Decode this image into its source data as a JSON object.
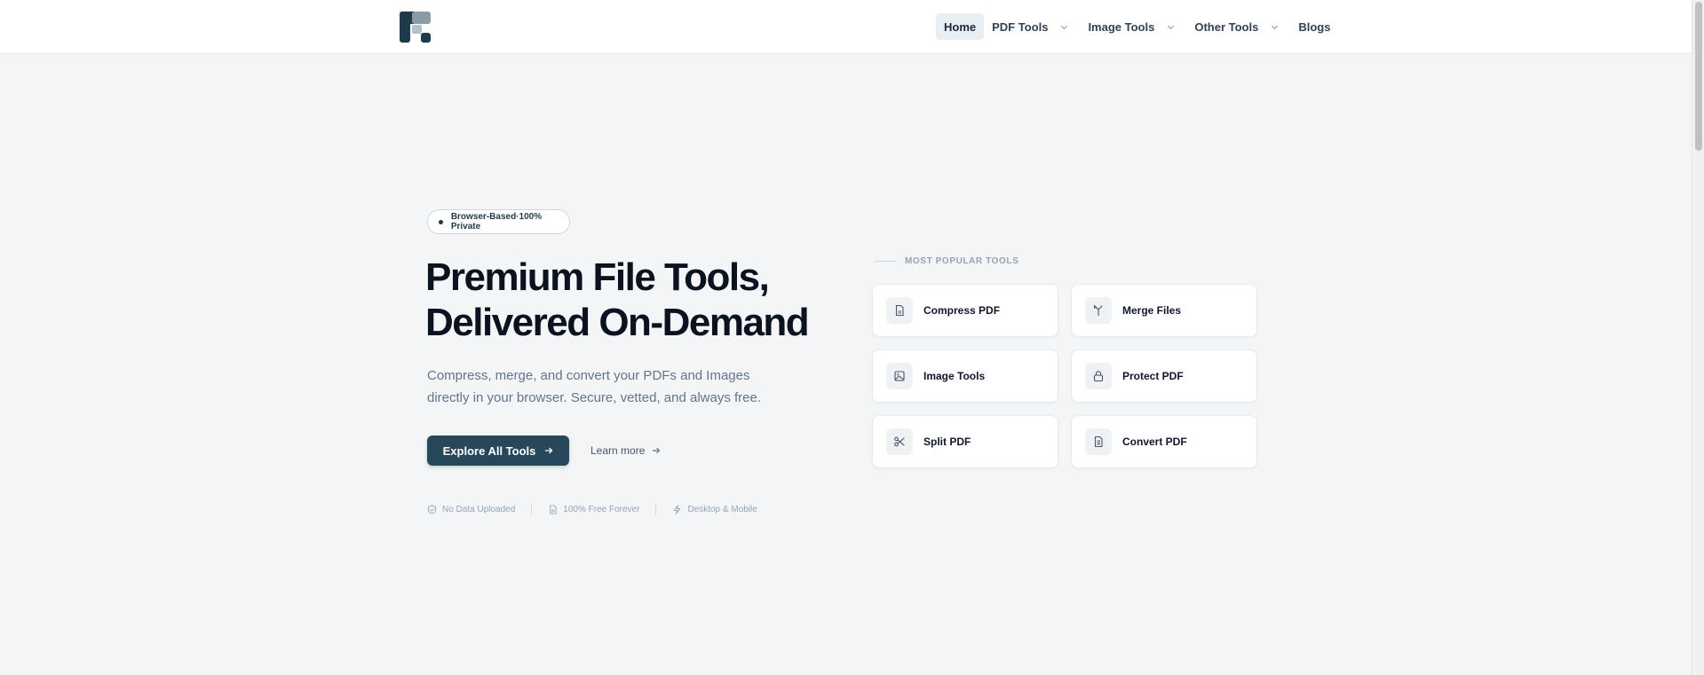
{
  "nav": {
    "home": "Home",
    "pdf_tools": "PDF Tools",
    "image_tools": "Image Tools",
    "other_tools": "Other Tools",
    "blogs": "Blogs"
  },
  "hero": {
    "badge": "Browser-Based·100% Private",
    "title_line1": "Premium File Tools,",
    "title_line2": "Delivered On-Demand",
    "subtitle_line1": "Compress, merge, and convert your PDFs and Images",
    "subtitle_line2": "directly in your browser. Secure, vetted, and always free.",
    "cta_primary": "Explore All Tools",
    "cta_secondary": "Learn more",
    "features": [
      "No Data Uploaded",
      "100% Free Forever",
      "Desktop & Mobile"
    ]
  },
  "popular": {
    "label": "MOST POPULAR TOOLS",
    "tools": [
      {
        "name": "Compress PDF",
        "icon": "document-icon"
      },
      {
        "name": "Merge Files",
        "icon": "merge-icon"
      },
      {
        "name": "Image Tools",
        "icon": "image-icon"
      },
      {
        "name": "Protect PDF",
        "icon": "lock-icon"
      },
      {
        "name": "Split PDF",
        "icon": "scissors-icon"
      },
      {
        "name": "Convert PDF",
        "icon": "file-text-icon"
      }
    ]
  },
  "colors": {
    "brand": "#27475a",
    "background": "#f3f5f6",
    "heading": "#0b1220",
    "muted": "#64748b"
  }
}
